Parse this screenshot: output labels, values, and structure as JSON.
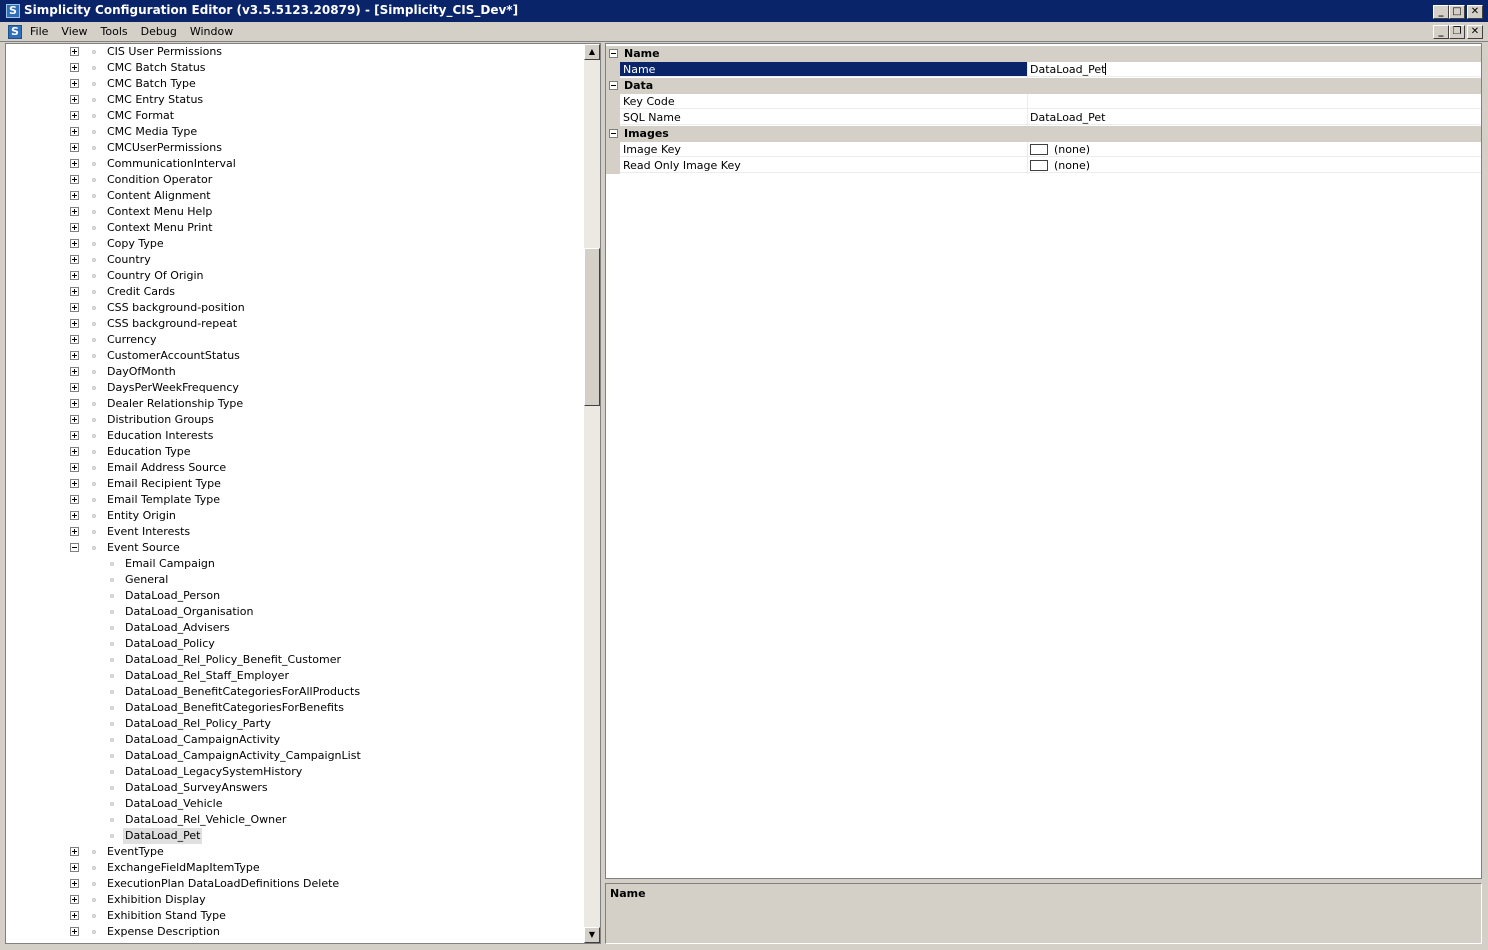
{
  "window": {
    "title": "Simplicity Configuration Editor (v3.5.5123.20879) - [Simplicity_CIS_Dev*]",
    "app_icon_letter": "S"
  },
  "menu": [
    "File",
    "View",
    "Tools",
    "Debug",
    "Window"
  ],
  "tree": {
    "items": [
      {
        "label": "CIS User Permissions",
        "level": 0,
        "state": "collapsed"
      },
      {
        "label": "CMC Batch Status",
        "level": 0,
        "state": "collapsed"
      },
      {
        "label": "CMC Batch Type",
        "level": 0,
        "state": "collapsed"
      },
      {
        "label": "CMC Entry Status",
        "level": 0,
        "state": "collapsed"
      },
      {
        "label": "CMC Format",
        "level": 0,
        "state": "collapsed"
      },
      {
        "label": "CMC Media Type",
        "level": 0,
        "state": "collapsed"
      },
      {
        "label": "CMCUserPermissions",
        "level": 0,
        "state": "collapsed"
      },
      {
        "label": "CommunicationInterval",
        "level": 0,
        "state": "collapsed"
      },
      {
        "label": "Condition Operator",
        "level": 0,
        "state": "collapsed"
      },
      {
        "label": "Content Alignment",
        "level": 0,
        "state": "collapsed"
      },
      {
        "label": "Context Menu Help",
        "level": 0,
        "state": "collapsed"
      },
      {
        "label": "Context Menu Print",
        "level": 0,
        "state": "collapsed"
      },
      {
        "label": "Copy Type",
        "level": 0,
        "state": "collapsed"
      },
      {
        "label": "Country",
        "level": 0,
        "state": "collapsed"
      },
      {
        "label": "Country Of Origin",
        "level": 0,
        "state": "collapsed"
      },
      {
        "label": "Credit Cards",
        "level": 0,
        "state": "collapsed"
      },
      {
        "label": "CSS background-position",
        "level": 0,
        "state": "collapsed"
      },
      {
        "label": "CSS background-repeat",
        "level": 0,
        "state": "collapsed"
      },
      {
        "label": "Currency",
        "level": 0,
        "state": "collapsed"
      },
      {
        "label": "CustomerAccountStatus",
        "level": 0,
        "state": "collapsed"
      },
      {
        "label": "DayOfMonth",
        "level": 0,
        "state": "collapsed"
      },
      {
        "label": "DaysPerWeekFrequency",
        "level": 0,
        "state": "collapsed"
      },
      {
        "label": "Dealer Relationship Type",
        "level": 0,
        "state": "collapsed"
      },
      {
        "label": "Distribution Groups",
        "level": 0,
        "state": "collapsed"
      },
      {
        "label": "Education Interests",
        "level": 0,
        "state": "collapsed"
      },
      {
        "label": "Education Type",
        "level": 0,
        "state": "collapsed"
      },
      {
        "label": "Email Address Source",
        "level": 0,
        "state": "collapsed"
      },
      {
        "label": "Email Recipient Type",
        "level": 0,
        "state": "collapsed"
      },
      {
        "label": "Email Template Type",
        "level": 0,
        "state": "collapsed"
      },
      {
        "label": "Entity Origin",
        "level": 0,
        "state": "collapsed"
      },
      {
        "label": "Event Interests",
        "level": 0,
        "state": "collapsed"
      },
      {
        "label": "Event Source",
        "level": 0,
        "state": "expanded"
      },
      {
        "label": "Email Campaign",
        "level": 1,
        "state": "leaf"
      },
      {
        "label": "General",
        "level": 1,
        "state": "leaf"
      },
      {
        "label": "DataLoad_Person",
        "level": 1,
        "state": "leaf"
      },
      {
        "label": "DataLoad_Organisation",
        "level": 1,
        "state": "leaf"
      },
      {
        "label": "DataLoad_Advisers",
        "level": 1,
        "state": "leaf"
      },
      {
        "label": "DataLoad_Policy",
        "level": 1,
        "state": "leaf"
      },
      {
        "label": "DataLoad_Rel_Policy_Benefit_Customer",
        "level": 1,
        "state": "leaf"
      },
      {
        "label": "DataLoad_Rel_Staff_Employer",
        "level": 1,
        "state": "leaf"
      },
      {
        "label": "DataLoad_BenefitCategoriesForAllProducts",
        "level": 1,
        "state": "leaf"
      },
      {
        "label": "DataLoad_BenefitCategoriesForBenefits",
        "level": 1,
        "state": "leaf"
      },
      {
        "label": "DataLoad_Rel_Policy_Party",
        "level": 1,
        "state": "leaf"
      },
      {
        "label": "DataLoad_CampaignActivity",
        "level": 1,
        "state": "leaf"
      },
      {
        "label": "DataLoad_CampaignActivity_CampaignList",
        "level": 1,
        "state": "leaf"
      },
      {
        "label": "DataLoad_LegacySystemHistory",
        "level": 1,
        "state": "leaf"
      },
      {
        "label": "DataLoad_SurveyAnswers",
        "level": 1,
        "state": "leaf"
      },
      {
        "label": "DataLoad_Vehicle",
        "level": 1,
        "state": "leaf"
      },
      {
        "label": "DataLoad_Rel_Vehicle_Owner",
        "level": 1,
        "state": "leaf"
      },
      {
        "label": "DataLoad_Pet",
        "level": 1,
        "state": "leaf",
        "selected": true
      },
      {
        "label": "EventType",
        "level": 0,
        "state": "collapsed"
      },
      {
        "label": "ExchangeFieldMapItemType",
        "level": 0,
        "state": "collapsed"
      },
      {
        "label": "ExecutionPlan DataLoadDefinitions Delete",
        "level": 0,
        "state": "collapsed"
      },
      {
        "label": "Exhibition Display",
        "level": 0,
        "state": "collapsed"
      },
      {
        "label": "Exhibition Stand Type",
        "level": 0,
        "state": "collapsed"
      },
      {
        "label": "Expense Description",
        "level": 0,
        "state": "collapsed"
      }
    ]
  },
  "properties": {
    "categories": [
      {
        "label": "Name",
        "rows": [
          {
            "name": "Name",
            "value": "DataLoad_Pet",
            "selected": true,
            "editing": true
          }
        ]
      },
      {
        "label": "Data",
        "rows": [
          {
            "name": "Key Code",
            "value": ""
          },
          {
            "name": "SQL Name",
            "value": "DataLoad_Pet"
          }
        ]
      },
      {
        "label": "Images",
        "rows": [
          {
            "name": "Image Key",
            "value": "(none)",
            "swatch": true
          },
          {
            "name": "Read Only Image Key",
            "value": "(none)",
            "swatch": true
          }
        ]
      }
    ]
  },
  "description": {
    "title": "Name"
  }
}
